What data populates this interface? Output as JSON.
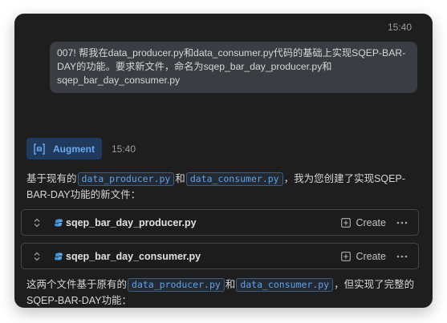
{
  "header": {
    "timestamp": "15:40"
  },
  "user_message": {
    "text": "007! 帮我在data_producer.py和data_consumer.py代码的基础上实现SQEP-BAR-DAY的功能。要求新文件，命名为sqep_bar_day_producer.py和sqep_bar_day_consumer.py"
  },
  "agent": {
    "name": "Augment",
    "timestamp": "15:40"
  },
  "response": {
    "para1": {
      "prefix": "基于现有的",
      "code1": "data_producer.py",
      "mid": "和",
      "code2": "data_consumer.py",
      "suffix": "，我为您创建了实现SQEP-BAR-DAY功能的新文件："
    },
    "para2": {
      "prefix": "这两个文件基于原有的",
      "code1": "data_producer.py",
      "mid": "和",
      "code2": "data_consumer.py",
      "suffix": "，但实现了完整的SQEP-BAR-DAY功能："
    }
  },
  "files": [
    {
      "name": "sqep_bar_day_producer.py",
      "action": "Create"
    },
    {
      "name": "sqep_bar_day_consumer.py",
      "action": "Create"
    }
  ],
  "colors": {
    "panel_bg": "#1e1e1f",
    "bubble_bg": "#3a3d41",
    "accent_blue": "#69a9ee",
    "code_text": "#5fa3ea",
    "python_icon": "#3e8fd6"
  }
}
